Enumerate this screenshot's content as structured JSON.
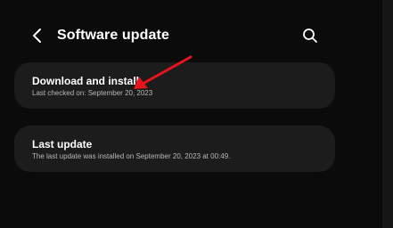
{
  "header": {
    "title": "Software update",
    "back_icon": "chevron-left-icon",
    "search_icon": "search-icon"
  },
  "items": [
    {
      "title": "Download and install",
      "subtitle": "Last checked on: September 20, 2023"
    },
    {
      "title": "Last update",
      "subtitle": "The last update was installed on September 20, 2023 at 00:49."
    }
  ],
  "annotation": {
    "arrow_color": "#e8141c"
  },
  "colors": {
    "background": "#0b0b0b",
    "card": "#1c1c1c",
    "text_primary": "#ffffff",
    "text_secondary": "#b8b8b8"
  }
}
